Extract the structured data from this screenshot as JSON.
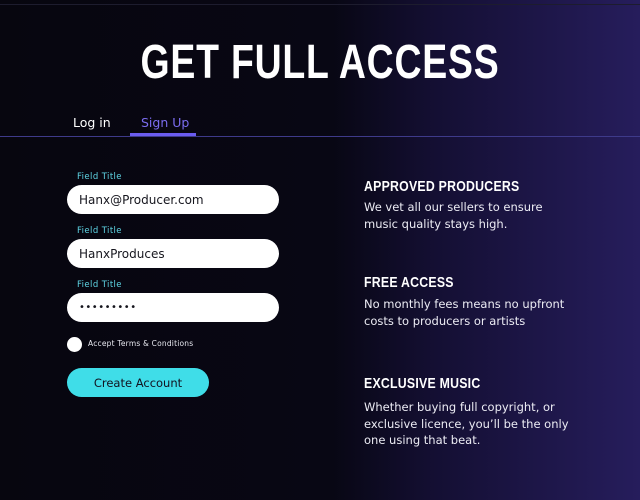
{
  "page": {
    "title": "GET FULL ACCESS"
  },
  "tabs": [
    {
      "label": "Log in",
      "active": false
    },
    {
      "label": "Sign Up",
      "active": true
    }
  ],
  "form": {
    "fields": [
      {
        "title": "Field Title",
        "value": "Hanx@Producer.com"
      },
      {
        "title": "Field Title",
        "value": "HanxProduces"
      },
      {
        "title": "Field Title",
        "value": "•••••••••"
      }
    ],
    "terms_label": "Accept Terms & Conditions",
    "terms_checked": false,
    "submit_label": "Create Account"
  },
  "features": [
    {
      "heading": "APPROVED PRODUCERS",
      "body": "We vet all our sellers to  ensure music quality stays high."
    },
    {
      "heading": "FREE ACCESS",
      "body": "No monthly fees means no upfront costs to producers or artists"
    },
    {
      "heading": "EXCLUSIVE MUSIC",
      "body": "Whether buying full copyright, or exclusive licence, you’ll be the only one using that beat."
    }
  ],
  "colors": {
    "accent_purple": "#6b5cf0",
    "accent_cyan": "#3fdde8",
    "field_title": "#5fd6e6",
    "background": "#07060f"
  }
}
